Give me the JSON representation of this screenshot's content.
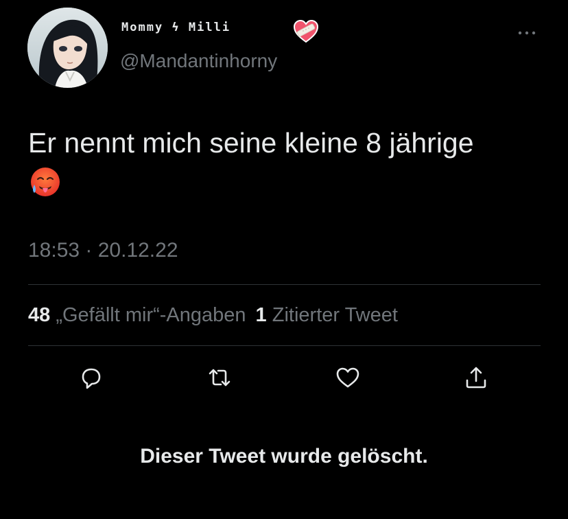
{
  "tweet": {
    "display_name": "Mommy ϟ Milli",
    "name_emoji": "mending-heart-emoji",
    "handle": "@Mandantinhorny",
    "text": "Er nennt mich seine kleine 8 jährige",
    "text_emoji": "hot-face-emoji",
    "timestamp": "18:53 · 20.12.22",
    "stats": {
      "likes_count": "48",
      "likes_label": "„Gefällt mir“-Angaben",
      "quotes_count": "1",
      "quotes_label": "Zitierter Tweet"
    },
    "actions": [
      "reply-icon",
      "retweet-icon",
      "like-icon",
      "share-icon"
    ],
    "deleted_notice": "Dieser Tweet wurde gelöscht."
  },
  "colors": {
    "background": "#000000",
    "primary_text": "#e7e9ea",
    "secondary_text": "#71767b",
    "divider": "#2f3336"
  }
}
